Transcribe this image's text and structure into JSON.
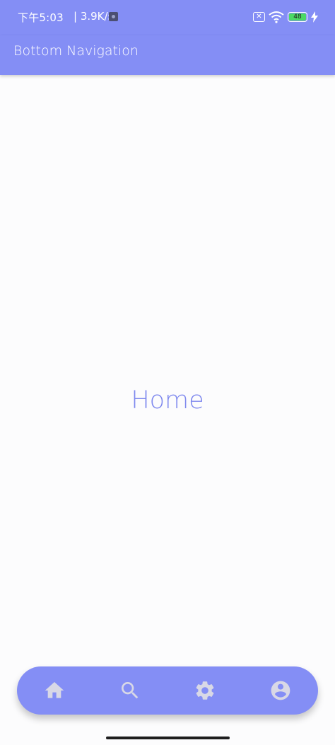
{
  "status_bar": {
    "time": "下午5:03",
    "net_speed": "| 3.9K/s",
    "sim_label": "✕",
    "battery_level": "48",
    "icons": [
      "app-notification-icon",
      "sim-icon",
      "wifi-icon",
      "battery-icon",
      "charging-icon"
    ]
  },
  "app_bar": {
    "title": "Bottom Navigation"
  },
  "content": {
    "label": "Home"
  },
  "bottom_nav": {
    "items": [
      {
        "icon": "home-icon"
      },
      {
        "icon": "search-icon"
      },
      {
        "icon": "settings-icon"
      },
      {
        "icon": "account-icon"
      }
    ]
  },
  "colors": {
    "primary": "#848ef5",
    "content_text": "#7f89ee",
    "background": "#fcfcfd",
    "nav_icon": "#d8d8e6"
  }
}
